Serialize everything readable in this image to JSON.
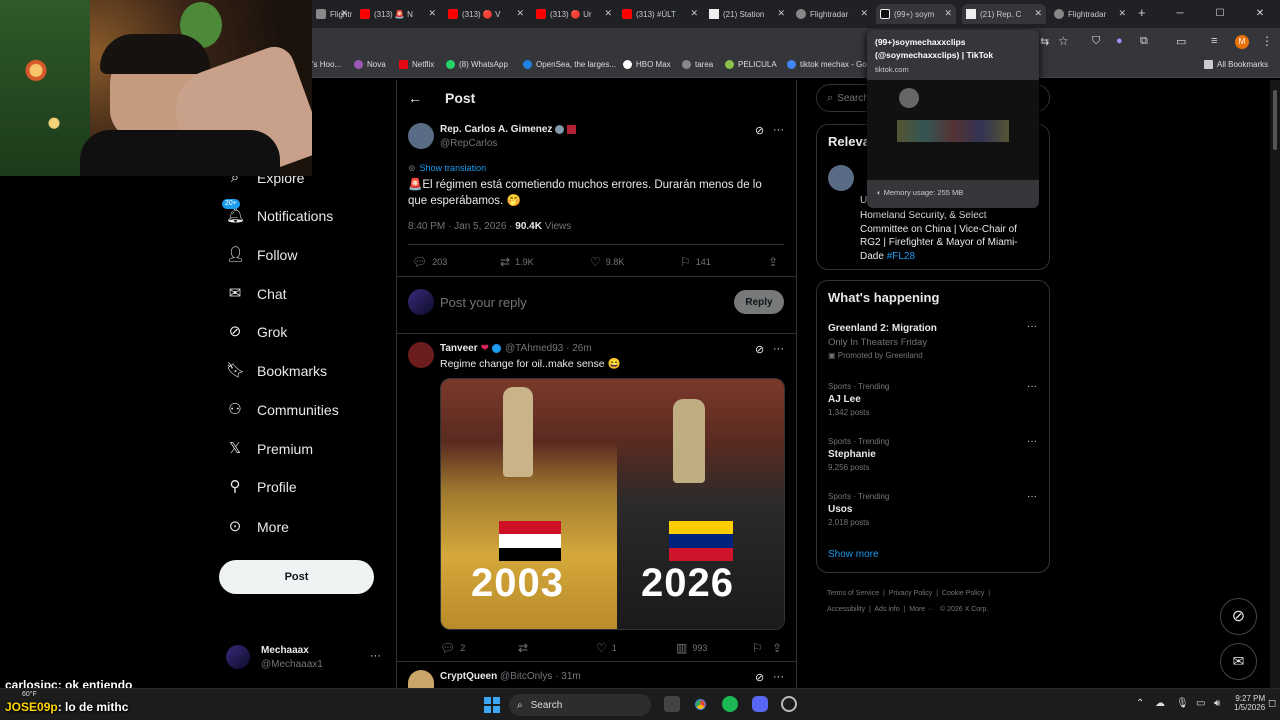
{
  "browser": {
    "tabs": [
      {
        "label": "Flightradar",
        "color": "#888"
      },
      {
        "label": "(313) 🚨 N",
        "color": "#ff0000"
      },
      {
        "label": "(313) 🔴 V",
        "color": "#ff0000"
      },
      {
        "label": "(313) 🔴 Ur",
        "color": "#ff0000"
      },
      {
        "label": "(313) #ÚLT",
        "color": "#ff0000"
      },
      {
        "label": "(21) Station",
        "color": "#eee"
      },
      {
        "label": "Flightradar",
        "color": "#888"
      },
      {
        "label": "(99+) soym",
        "color": "#eee"
      },
      {
        "label": "(21) Rep. C",
        "color": "#eee"
      },
      {
        "label": "Flightradar",
        "color": "#888"
      }
    ],
    "new_tab": "+",
    "bookmarks": [
      "'s Hoo...",
      "Nova",
      "Netflix",
      "(8) WhatsApp",
      "OpenSea, the larges...",
      "HBO Max",
      "tarea",
      "PELICULA",
      "tiktok mechax - Go"
    ],
    "all_bookmarks": "All Bookmarks",
    "tooltip": {
      "title": "(99+)soymechaxxclips (@soymechaxxclips) | TikTok",
      "domain": "tiktok.com",
      "memory": "Memory usage: 255 MB"
    }
  },
  "sidebar": {
    "items": [
      {
        "label": "Explore",
        "icon": "search-icon"
      },
      {
        "label": "Notifications",
        "icon": "bell-icon",
        "badge": "20+"
      },
      {
        "label": "Follow",
        "icon": "add-user-icon"
      },
      {
        "label": "Chat",
        "icon": "mail-icon"
      },
      {
        "label": "Grok",
        "icon": "grok-icon"
      },
      {
        "label": "Bookmarks",
        "icon": "bookmark-icon"
      },
      {
        "label": "Communities",
        "icon": "communities-icon"
      },
      {
        "label": "Premium",
        "icon": "x-logo-icon"
      },
      {
        "label": "Profile",
        "icon": "profile-icon"
      },
      {
        "label": "More",
        "icon": "more-circle-icon"
      }
    ],
    "post_button": "Post",
    "account": {
      "name": "Mechaaax",
      "handle": "@Mechaaax1",
      "more": "···"
    }
  },
  "main": {
    "header": "Post",
    "post": {
      "author": "Rep. Carlos A. Gimenez",
      "handle": "@RepCarlos",
      "show_translation": "Show translation",
      "text": "🚨El régimen está cometiendo muchos errores. Durarán menos de lo que esperábamos. 🤭",
      "time": "8:40 PM · Jan 5, 2026 · ",
      "views_count": "90.4K",
      "views_label": " Views",
      "replies": "203",
      "reposts": "1.9K",
      "likes": "9.8K",
      "bookmarks": "141"
    },
    "reply_box": {
      "placeholder": "Post your reply",
      "button": "Reply"
    },
    "reply1": {
      "author": "Tanveer",
      "handle": "@TAhmed93 · 26m",
      "text": "Regime change for oil..make sense 😄",
      "image_left_year": "2003",
      "image_right_year": "2026",
      "replies": "2",
      "reposts": "",
      "likes": "1",
      "views": "993"
    },
    "reply2": {
      "author": "CryptQueen",
      "handle": "@BitcOnlys · 31m"
    }
  },
  "right": {
    "search_placeholder": "Search",
    "relevant": {
      "title": "Releva",
      "bio_prefix": "U",
      "bio": "Homeland Security, & Select Committee on China | Vice-Chair of RG2 | Firefighter & Mayor of Miami-Dade ",
      "hashtag": "#FL28"
    },
    "happening_title": "What's happening",
    "trends": [
      {
        "meta": "",
        "title": "Greenland 2: Migration",
        "sub": "Only In Theaters Friday",
        "promo": "Promoted by Greenland"
      },
      {
        "meta": "Sports · Trending",
        "title": "AJ Lee",
        "sub": "1,342 posts",
        "promo": ""
      },
      {
        "meta": "Sports · Trending",
        "title": "Stephanie",
        "sub": "9,256 posts",
        "promo": ""
      },
      {
        "meta": "Sports · Trending",
        "title": "Usos",
        "sub": "2,018 posts",
        "promo": ""
      }
    ],
    "show_more": "Show more",
    "footer": [
      "Terms of Service",
      "Privacy Policy",
      "Cookie Policy",
      "Accessibility",
      "Ads info",
      "More ···",
      "© 2026 X Corp."
    ]
  },
  "chat_overlay": [
    {
      "user": "carlosipc",
      "msg": ": ok entiendo",
      "color": "#ffffff"
    },
    {
      "user": "JOSE09p",
      "msg": ": lo de mithc",
      "color": "#ffd400"
    }
  ],
  "taskbar": {
    "search": "Search",
    "weather": "60°F",
    "time": "9:27 PM",
    "date": "1/5/2026"
  }
}
